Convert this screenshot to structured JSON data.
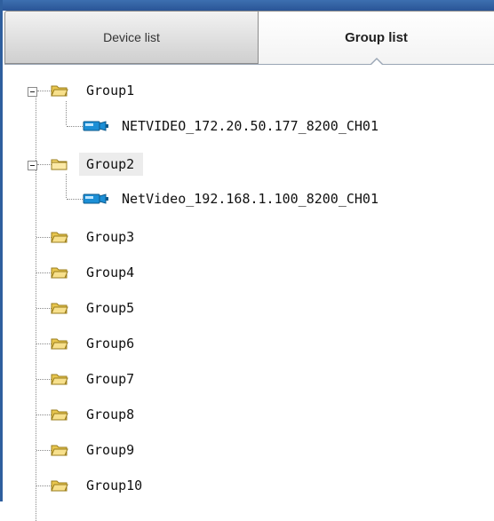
{
  "tabs": {
    "device_list": "Device list",
    "group_list": "Group list"
  },
  "tree": {
    "groups": [
      {
        "label": "Group1",
        "children": [
          "NETVIDEO_172.20.50.177_8200_CH01"
        ],
        "expanded": true
      },
      {
        "label": "Group2",
        "children": [
          "NetVideo_192.168.1.100_8200_CH01"
        ],
        "expanded": true,
        "selected": true
      },
      {
        "label": "Group3"
      },
      {
        "label": "Group4"
      },
      {
        "label": "Group5"
      },
      {
        "label": "Group6"
      },
      {
        "label": "Group7"
      },
      {
        "label": "Group8"
      },
      {
        "label": "Group9"
      },
      {
        "label": "Group10"
      }
    ]
  },
  "colors": {
    "title_bar": "#2f5f9e",
    "folder": "#f5d76e",
    "camera": "#1c8fd6",
    "tree_lines": "#8a8a8a"
  }
}
